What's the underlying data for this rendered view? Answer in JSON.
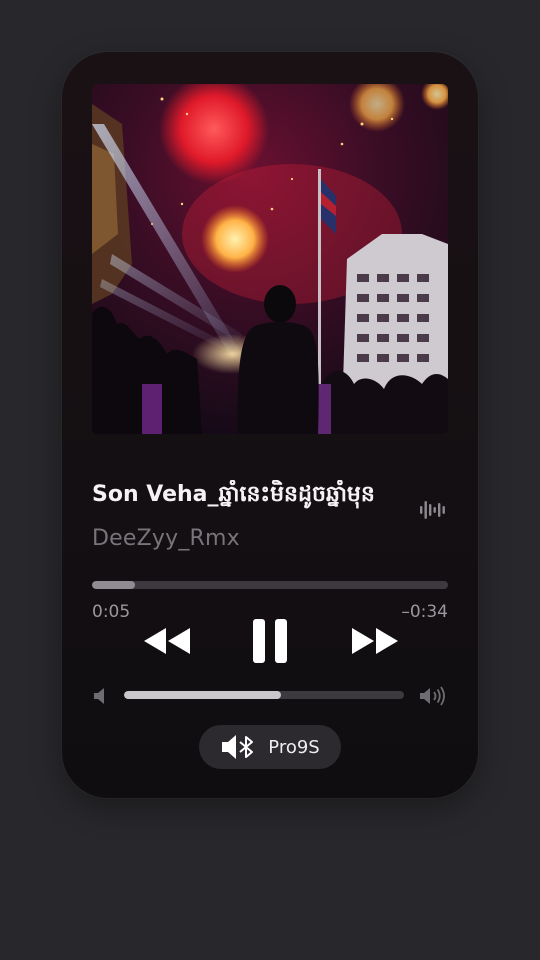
{
  "track": {
    "title": "Son Veha_ឆ្នាំនេះមិនដូចឆ្នាំមុន",
    "artist": "DeeZyy_Rmx",
    "artwork_icon": "fireworks-concert-photo"
  },
  "playback": {
    "elapsed": "0:05",
    "remaining": "–0:34",
    "progress_fraction": 0.12,
    "state": "playing"
  },
  "controls": {
    "rewind_icon": "backward-icon",
    "pause_icon": "pause-icon",
    "forward_icon": "forward-icon"
  },
  "volume": {
    "level_fraction": 0.56,
    "low_icon": "speaker-low-icon",
    "high_icon": "speaker-high-icon"
  },
  "output_device": {
    "name": "Pro9S",
    "icon": "bluetooth-speaker-icon"
  },
  "colors": {
    "background": "#28272b",
    "card": "#161013",
    "text_primary": "#f4f2f5",
    "text_secondary": "#77747a",
    "track_bg": "#3c3a3f"
  }
}
